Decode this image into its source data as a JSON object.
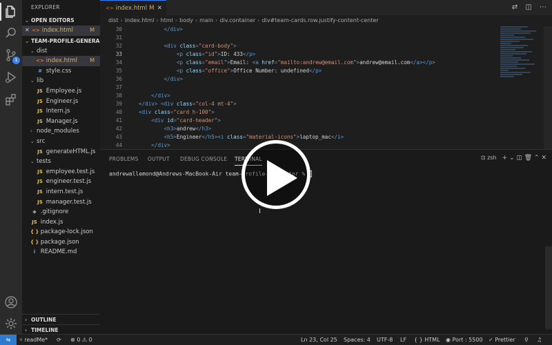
{
  "explorer": {
    "title": "EXPLORER",
    "open_editors_title": "OPEN EDITORS",
    "open_editor": {
      "name": "index.html",
      "suffix": "M"
    },
    "project_title": "TEAM-PROFILE-GENERA...",
    "items": [
      {
        "label": "dist",
        "type": "folder",
        "open": true,
        "indent": 1
      },
      {
        "label": "index.html",
        "type": "html",
        "indent": 2,
        "mark": "M",
        "selected": true
      },
      {
        "label": "style.css",
        "type": "css",
        "indent": 2
      },
      {
        "label": "lib",
        "type": "folder",
        "open": true,
        "indent": 1
      },
      {
        "label": "Employee.js",
        "type": "js",
        "indent": 2
      },
      {
        "label": "Engineer.js",
        "type": "js",
        "indent": 2
      },
      {
        "label": "Intern.js",
        "type": "js",
        "indent": 2
      },
      {
        "label": "Manager.js",
        "type": "js",
        "indent": 2
      },
      {
        "label": "node_modules",
        "type": "folder",
        "open": false,
        "indent": 1
      },
      {
        "label": "src",
        "type": "folder",
        "open": true,
        "indent": 1
      },
      {
        "label": "generateHTML.js",
        "type": "js",
        "indent": 2
      },
      {
        "label": "tests",
        "type": "folder",
        "open": true,
        "indent": 1
      },
      {
        "label": "employee.test.js",
        "type": "test",
        "indent": 2
      },
      {
        "label": "engineer.test.js",
        "type": "test",
        "indent": 2
      },
      {
        "label": "intern.test.js",
        "type": "test",
        "indent": 2
      },
      {
        "label": "manager.test.js",
        "type": "test",
        "indent": 2
      },
      {
        "label": ".gitignore",
        "type": "git",
        "indent": 1
      },
      {
        "label": "index.js",
        "type": "js",
        "indent": 1
      },
      {
        "label": "package-lock.json",
        "type": "json",
        "indent": 1
      },
      {
        "label": "package.json",
        "type": "json",
        "indent": 1
      },
      {
        "label": "README.md",
        "type": "info",
        "indent": 1
      }
    ],
    "outline_title": "OUTLINE",
    "timeline_title": "TIMELINE"
  },
  "icons": {
    "html": "<>",
    "css": "#",
    "js": "JS",
    "json": "{ }",
    "info": "i",
    "git": "◆"
  },
  "editor": {
    "tab_name": "index.html",
    "tab_mark": "M",
    "toolbar_icons": "⇄ ◫ ⋯",
    "breadcrumb": [
      "dist",
      "index.html",
      "html",
      "body",
      "main",
      "div.container",
      "div#team-cards.row.justify-content-center"
    ],
    "lines": [
      {
        "n": "30",
        "indent": 4,
        "parts": [
          [
            "tag",
            "</div>"
          ]
        ]
      },
      {
        "n": "31",
        "indent": 0,
        "parts": []
      },
      {
        "n": "32",
        "indent": 4,
        "parts": [
          [
            "tag",
            "<div "
          ],
          [
            "attr",
            "class"
          ],
          [
            "punct",
            "="
          ],
          [
            "str",
            "\"card-body\""
          ],
          [
            "tag",
            ">"
          ]
        ]
      },
      {
        "n": "33",
        "indent": 6,
        "current": true,
        "parts": [
          [
            "tag",
            "<p "
          ],
          [
            "attr",
            "class"
          ],
          [
            "punct",
            "="
          ],
          [
            "str",
            "\"id\""
          ],
          [
            "tag",
            ">"
          ],
          [
            "txt",
            "ID: 433"
          ],
          [
            "tag",
            "</p>"
          ]
        ]
      },
      {
        "n": "34",
        "indent": 6,
        "parts": [
          [
            "tag",
            "<p "
          ],
          [
            "attr",
            "class"
          ],
          [
            "punct",
            "="
          ],
          [
            "str",
            "\"email\""
          ],
          [
            "tag",
            ">"
          ],
          [
            "txt",
            "Email: "
          ],
          [
            "tag",
            "<a "
          ],
          [
            "attr",
            "href"
          ],
          [
            "punct",
            "="
          ],
          [
            "str",
            "\"mailto:andrew@email.com\""
          ],
          [
            "tag",
            ">"
          ],
          [
            "txt",
            "andrew@email.com"
          ],
          [
            "tag",
            "</a></p>"
          ]
        ]
      },
      {
        "n": "35",
        "indent": 6,
        "parts": [
          [
            "tag",
            "<p "
          ],
          [
            "attr",
            "class"
          ],
          [
            "punct",
            "="
          ],
          [
            "str",
            "\"office\""
          ],
          [
            "tag",
            ">"
          ],
          [
            "txt",
            "Office Number: undefined"
          ],
          [
            "tag",
            "</p>"
          ]
        ]
      },
      {
        "n": "36",
        "indent": 4,
        "parts": [
          [
            "tag",
            "</div>"
          ]
        ]
      },
      {
        "n": "37",
        "indent": 0,
        "parts": []
      },
      {
        "n": "38",
        "indent": 2,
        "parts": [
          [
            "tag",
            "</div>"
          ]
        ]
      },
      {
        "n": "39",
        "indent": 0,
        "parts": [
          [
            "tag",
            "</div> <div "
          ],
          [
            "attr",
            "class"
          ],
          [
            "punct",
            "="
          ],
          [
            "str",
            "\"col-4 mt-4\""
          ],
          [
            "tag",
            ">"
          ]
        ]
      },
      {
        "n": "40",
        "indent": 0,
        "parts": [
          [
            "tag",
            "<div "
          ],
          [
            "attr",
            "class"
          ],
          [
            "punct",
            "="
          ],
          [
            "str",
            "\"card h-100\""
          ],
          [
            "tag",
            ">"
          ]
        ]
      },
      {
        "n": "41",
        "indent": 2,
        "parts": [
          [
            "tag",
            "<div "
          ],
          [
            "attr",
            "id"
          ],
          [
            "punct",
            "="
          ],
          [
            "str",
            "\"card-header\""
          ],
          [
            "tag",
            ">"
          ]
        ]
      },
      {
        "n": "42",
        "indent": 4,
        "parts": [
          [
            "tag",
            "<h3>"
          ],
          [
            "txt",
            "andrew"
          ],
          [
            "tag",
            "</h3>"
          ]
        ]
      },
      {
        "n": "43",
        "indent": 4,
        "parts": [
          [
            "tag",
            "<h5>"
          ],
          [
            "txt",
            "Engineer"
          ],
          [
            "tag",
            "</h5><i "
          ],
          [
            "attr",
            "class"
          ],
          [
            "punct",
            "="
          ],
          [
            "str",
            "\"material-icons\""
          ],
          [
            "tag",
            ">"
          ],
          [
            "txt",
            "laptop_mac"
          ],
          [
            "tag",
            "</i>"
          ]
        ]
      },
      {
        "n": "44",
        "indent": 2,
        "parts": [
          [
            "tag",
            "</div>"
          ]
        ]
      }
    ]
  },
  "panel": {
    "tabs": [
      "PROBLEMS",
      "OUTPUT",
      "DEBUG CONSOLE",
      "TERMINAL"
    ],
    "active_tab": "TERMINAL",
    "shell": "zsh",
    "tool_icons": "+ ⌄ ◫ 🗑 ⌃ ✕",
    "terminal_line": "andrewallemond@Andrews-MacBook-Air team-profile-generator % "
  },
  "status": {
    "branch": "readMe*",
    "errors": "0",
    "warnings": "0",
    "position": "Ln 23, Col 25",
    "spaces": "Spaces: 4",
    "encoding": "UTF-8",
    "eol": "LF",
    "language": "HTML",
    "port": "Port : 5500",
    "prettier": "Prettier"
  }
}
